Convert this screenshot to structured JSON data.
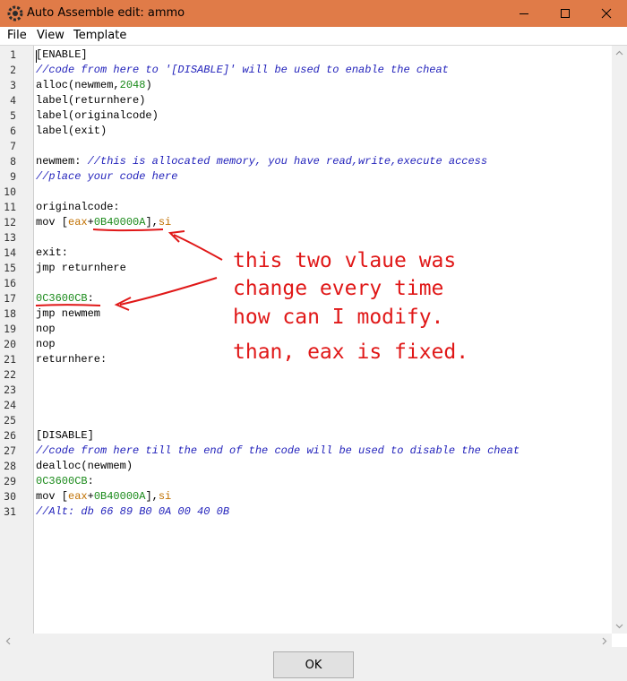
{
  "window": {
    "title": "Auto Assemble edit: ammo"
  },
  "menu": [
    {
      "label": "File"
    },
    {
      "label": "View"
    },
    {
      "label": "Template"
    }
  ],
  "code_lines": [
    [
      {
        "t": "[ENABLE]",
        "c": ""
      }
    ],
    [
      {
        "t": "//code from here to '[DISABLE]' will be used to enable the cheat",
        "c": "cmt"
      }
    ],
    [
      {
        "t": "alloc",
        "c": ""
      },
      {
        "t": "(newmem,",
        "c": ""
      },
      {
        "t": "2048",
        "c": "num"
      },
      {
        "t": ")",
        "c": ""
      }
    ],
    [
      {
        "t": "label(returnhere)",
        "c": ""
      }
    ],
    [
      {
        "t": "label(originalcode)",
        "c": ""
      }
    ],
    [
      {
        "t": "label(exit)",
        "c": ""
      }
    ],
    [],
    [
      {
        "t": "newmem: ",
        "c": ""
      },
      {
        "t": "//this is allocated memory, you have read,write,execute access",
        "c": "cmt"
      }
    ],
    [
      {
        "t": "//place your code here",
        "c": "cmt"
      }
    ],
    [],
    [
      {
        "t": "originalcode:",
        "c": ""
      }
    ],
    [
      {
        "t": "mov [",
        "c": ""
      },
      {
        "t": "eax",
        "c": "reg"
      },
      {
        "t": "+",
        "c": ""
      },
      {
        "t": "0B40000A",
        "c": "num"
      },
      {
        "t": "],",
        "c": ""
      },
      {
        "t": "si",
        "c": "reg"
      }
    ],
    [],
    [
      {
        "t": "exit:",
        "c": ""
      }
    ],
    [
      {
        "t": "jmp returnhere",
        "c": ""
      }
    ],
    [],
    [
      {
        "t": "0C3600CB",
        "c": "num"
      },
      {
        "t": ":",
        "c": ""
      }
    ],
    [
      {
        "t": "jmp newmem",
        "c": ""
      }
    ],
    [
      {
        "t": "nop",
        "c": ""
      }
    ],
    [
      {
        "t": "nop",
        "c": ""
      }
    ],
    [
      {
        "t": "returnhere:",
        "c": ""
      }
    ],
    [],
    [],
    [],
    [],
    [
      {
        "t": "[DISABLE]",
        "c": ""
      }
    ],
    [
      {
        "t": "//code from here till the end of the code will be used to disable the cheat",
        "c": "cmt"
      }
    ],
    [
      {
        "t": "dealloc(newmem)",
        "c": ""
      }
    ],
    [
      {
        "t": "0C3600CB",
        "c": "num"
      },
      {
        "t": ":",
        "c": ""
      }
    ],
    [
      {
        "t": "mov [",
        "c": ""
      },
      {
        "t": "eax",
        "c": "reg"
      },
      {
        "t": "+",
        "c": ""
      },
      {
        "t": "0B40000A",
        "c": "num"
      },
      {
        "t": "],",
        "c": ""
      },
      {
        "t": "si",
        "c": "reg"
      }
    ],
    [
      {
        "t": "//Alt: db 66 89 B0 0A 00 40 0B",
        "c": "cmt"
      }
    ]
  ],
  "annotation": {
    "line1": "this two vlaue was",
    "line2": "change every time",
    "line3": "how can I modify.",
    "line4": "than, eax is fixed."
  },
  "footer": {
    "ok_label": "OK"
  },
  "colors": {
    "titlebar": "#e07b48",
    "comment": "#2222bb",
    "number": "#1a8a1a",
    "register": "#c07000",
    "annotation": "#e01818"
  }
}
